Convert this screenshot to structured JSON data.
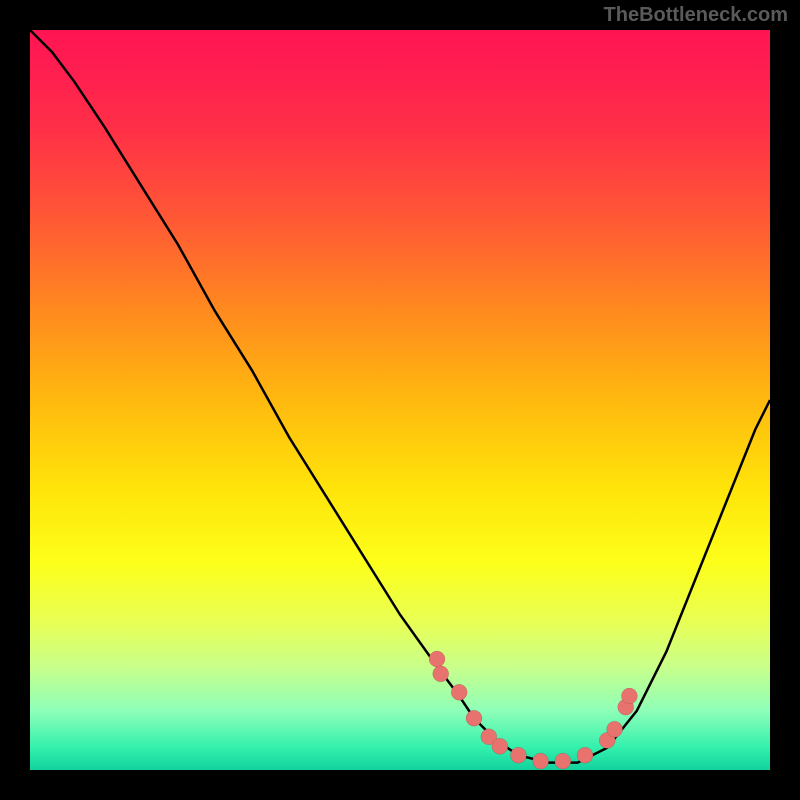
{
  "watermark": "TheBottleneck.com",
  "chart_data": {
    "type": "line",
    "title": "",
    "xlabel": "",
    "ylabel": "",
    "xlim": [
      0,
      100
    ],
    "ylim": [
      0,
      100
    ],
    "grid": false,
    "series": [
      {
        "name": "curve",
        "x": [
          0,
          3,
          6,
          10,
          15,
          20,
          25,
          30,
          35,
          40,
          45,
          50,
          55,
          58,
          60,
          63,
          66,
          70,
          74,
          78,
          82,
          86,
          90,
          94,
          98,
          100
        ],
        "values": [
          100,
          97,
          93,
          87,
          79,
          71,
          62,
          54,
          45,
          37,
          29,
          21,
          14,
          10,
          7,
          4,
          2,
          1,
          1,
          3,
          8,
          16,
          26,
          36,
          46,
          50
        ]
      },
      {
        "name": "dots",
        "x": [
          55,
          55.5,
          58,
          60,
          62,
          63.5,
          66,
          69,
          72,
          75,
          78,
          79,
          80.5,
          81
        ],
        "values": [
          15,
          13,
          10.5,
          7,
          4.5,
          3.2,
          2,
          1.2,
          1.2,
          2,
          4,
          5.5,
          8.5,
          10
        ]
      }
    ]
  }
}
